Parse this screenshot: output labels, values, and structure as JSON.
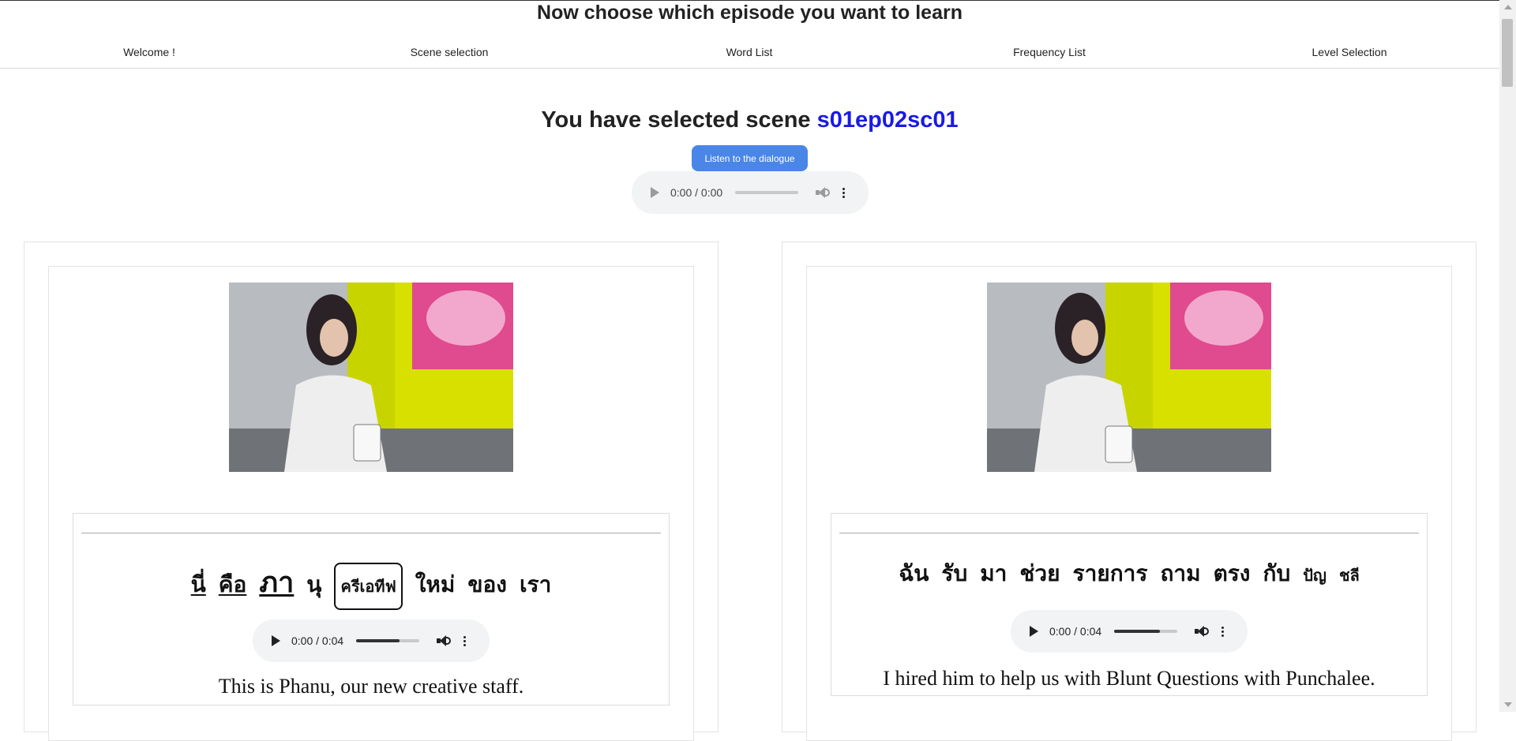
{
  "header": {
    "title": "Now choose which episode you want to learn"
  },
  "nav": [
    {
      "label": "Welcome !"
    },
    {
      "label": "Scene selection"
    },
    {
      "label": "Word List"
    },
    {
      "label": "Frequency List"
    },
    {
      "label": "Level Selection"
    }
  ],
  "selection": {
    "prefix": "You have selected scene",
    "scene_id": "s01ep02sc01",
    "scene_id_color": "#1a1ae6",
    "listen_label": "Listen to the dialogue"
  },
  "main_audio": {
    "time": "0:00 / 0:00",
    "progress": 0
  },
  "cards": [
    {
      "image_alt": "scene-still",
      "words": [
        {
          "text": "นี่",
          "style": "underlined"
        },
        {
          "text": "คือ",
          "style": "underlined"
        },
        {
          "text": "ภา",
          "style": "underlined-large"
        },
        {
          "text": "นุ",
          "style": "plain"
        },
        {
          "text": "ครีเอทีฟ",
          "style": "boxed"
        },
        {
          "text": "ใหม่",
          "style": "plain"
        },
        {
          "text": "ของ",
          "style": "plain"
        },
        {
          "text": "เรา",
          "style": "plain"
        }
      ],
      "audio_time": "0:00 / 0:04",
      "audio_progress": 0.6,
      "english": "This is Phanu, our new creative staff."
    },
    {
      "image_alt": "scene-still",
      "words": [
        {
          "text": "ฉัน",
          "style": "plain"
        },
        {
          "text": "รับ",
          "style": "plain"
        },
        {
          "text": "มา",
          "style": "plain"
        },
        {
          "text": "ช่วย",
          "style": "plain"
        },
        {
          "text": "รายการ",
          "style": "plain"
        },
        {
          "text": "ถาม",
          "style": "plain"
        },
        {
          "text": "ตรง",
          "style": "plain"
        },
        {
          "text": "กับ",
          "style": "plain"
        },
        {
          "text": "ปัญ",
          "style": "small"
        },
        {
          "text": "ชลี",
          "style": "small"
        }
      ],
      "audio_time": "0:00 / 0:04",
      "audio_progress": 0.7,
      "english": "I hired him to help us with Blunt Questions with Punchalee."
    }
  ],
  "colors": {
    "accent": "#4a86e8",
    "scene_id": "#1a1ae6"
  }
}
